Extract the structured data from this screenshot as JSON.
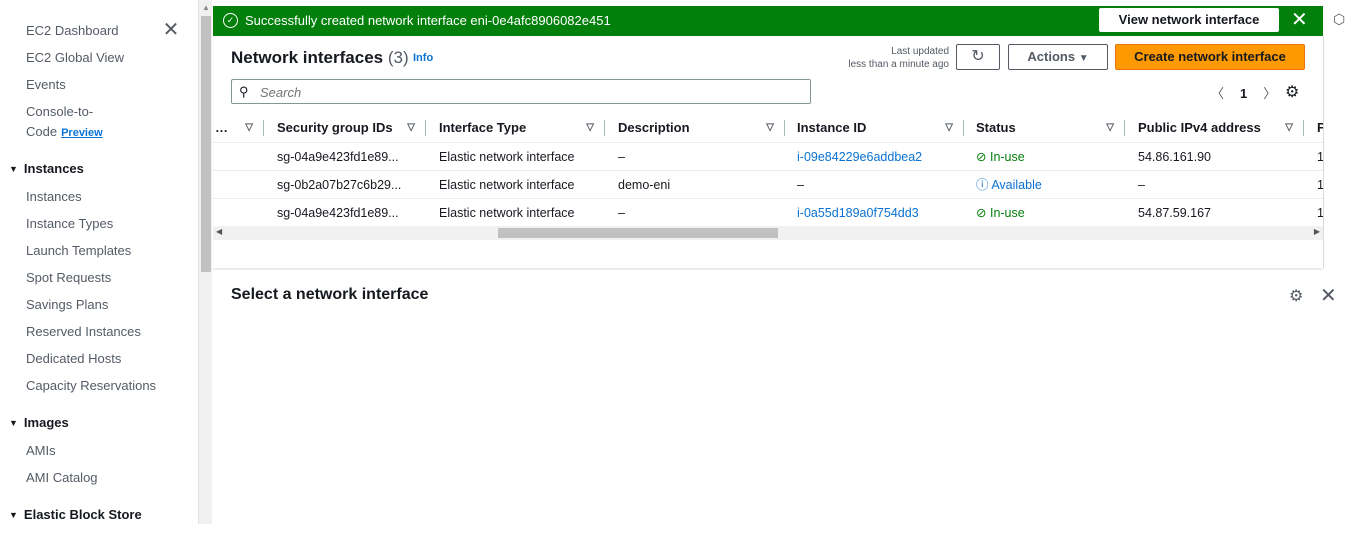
{
  "sidebar": {
    "top_links": [
      "EC2 Dashboard",
      "EC2 Global View",
      "Events"
    ],
    "console_to_code": {
      "line1": "Console-to-",
      "line2": "Code",
      "badge": "Preview"
    },
    "instances": {
      "heading": "Instances",
      "items": [
        "Instances",
        "Instance Types",
        "Launch Templates",
        "Spot Requests",
        "Savings Plans",
        "Reserved Instances",
        "Dedicated Hosts",
        "Capacity Reservations"
      ]
    },
    "images": {
      "heading": "Images",
      "items": [
        "AMIs",
        "AMI Catalog"
      ]
    },
    "ebs": {
      "heading": "Elastic Block Store"
    }
  },
  "flash": {
    "message": "Successfully created network interface eni-0e4afc8906082e451",
    "button": "View network interface"
  },
  "header": {
    "title": "Network interfaces",
    "count": "(3)",
    "info": "Info",
    "last_updated_1": "Last updated",
    "last_updated_2": "less than a minute ago",
    "actions": "Actions",
    "create": "Create network interface"
  },
  "search": {
    "placeholder": "Search"
  },
  "pagination": {
    "current": "1"
  },
  "table": {
    "columns": [
      "Security group IDs",
      "Interface Type",
      "Description",
      "Instance ID",
      "Status",
      "Public IPv4 address"
    ],
    "rows": [
      {
        "sg": "sg-04a9e423fd1e89...",
        "type": "Elastic network interface",
        "desc": "–",
        "instance": "i-09e84229e6addbea2",
        "status": "In-use",
        "ip": "54.86.161.90",
        "extra": "1"
      },
      {
        "sg": "sg-0b2a07b27c6b29...",
        "type": "Elastic network interface",
        "desc": "demo-eni",
        "instance": "–",
        "status": "Available",
        "ip": "–",
        "extra": "1"
      },
      {
        "sg": "sg-04a9e423fd1e89...",
        "type": "Elastic network interface",
        "desc": "–",
        "instance": "i-0a55d189a0f754dd3",
        "status": "In-use",
        "ip": "54.87.59.167",
        "extra": "1"
      }
    ]
  },
  "bottom": {
    "title": "Select a network interface"
  }
}
